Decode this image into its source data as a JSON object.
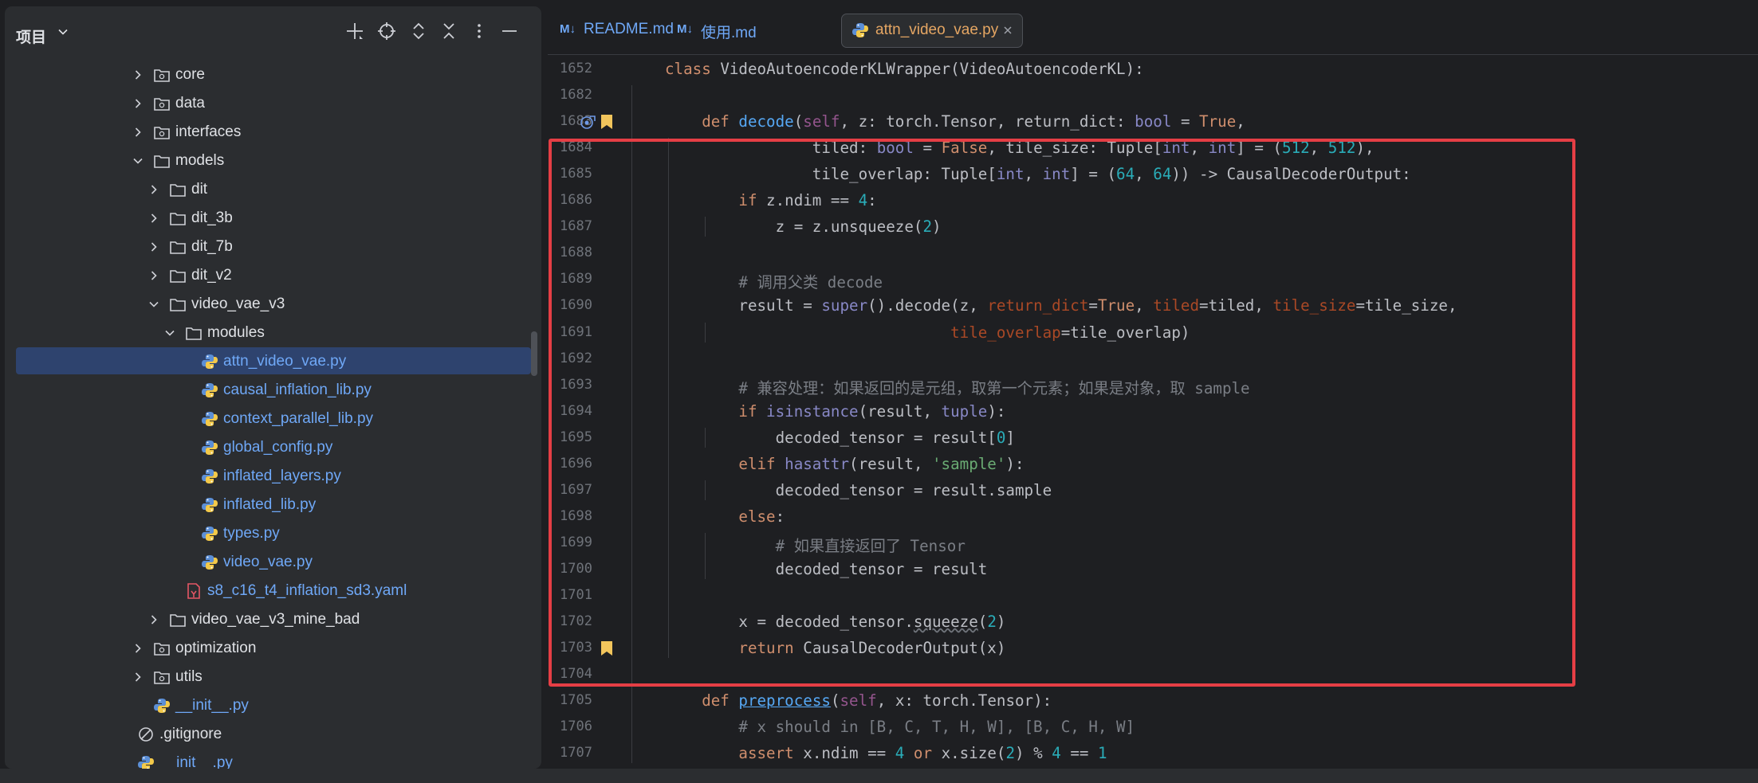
{
  "project_panel": {
    "title": "项目",
    "toolbar_icons": [
      "add-icon",
      "locate-icon",
      "expand-all-icon",
      "collapse-all-icon",
      "more-options-icon",
      "hide-icon"
    ],
    "tree": [
      {
        "label": "core",
        "kind": "package",
        "depth": 2,
        "expanded": false
      },
      {
        "label": "data",
        "kind": "package",
        "depth": 2,
        "expanded": false
      },
      {
        "label": "interfaces",
        "kind": "package",
        "depth": 2,
        "expanded": false
      },
      {
        "label": "models",
        "kind": "folder",
        "depth": 2,
        "expanded": true
      },
      {
        "label": "dit",
        "kind": "folder",
        "depth": 3,
        "expanded": false
      },
      {
        "label": "dit_3b",
        "kind": "folder",
        "depth": 3,
        "expanded": false
      },
      {
        "label": "dit_7b",
        "kind": "folder",
        "depth": 3,
        "expanded": false
      },
      {
        "label": "dit_v2",
        "kind": "folder",
        "depth": 3,
        "expanded": false
      },
      {
        "label": "video_vae_v3",
        "kind": "folder",
        "depth": 3,
        "expanded": true
      },
      {
        "label": "modules",
        "kind": "folder",
        "depth": 4,
        "expanded": true
      },
      {
        "label": "attn_video_vae.py",
        "kind": "python",
        "depth": 5,
        "selected": true
      },
      {
        "label": "causal_inflation_lib.py",
        "kind": "python",
        "depth": 5
      },
      {
        "label": "context_parallel_lib.py",
        "kind": "python",
        "depth": 5
      },
      {
        "label": "global_config.py",
        "kind": "python",
        "depth": 5
      },
      {
        "label": "inflated_layers.py",
        "kind": "python",
        "depth": 5
      },
      {
        "label": "inflated_lib.py",
        "kind": "python",
        "depth": 5
      },
      {
        "label": "types.py",
        "kind": "python",
        "depth": 5
      },
      {
        "label": "video_vae.py",
        "kind": "python",
        "depth": 5
      },
      {
        "label": "s8_c16_t4_inflation_sd3.yaml",
        "kind": "yaml",
        "depth": 4
      },
      {
        "label": "video_vae_v3_mine_bad",
        "kind": "folder",
        "depth": 3,
        "expanded": false
      },
      {
        "label": "optimization",
        "kind": "package",
        "depth": 2,
        "expanded": false
      },
      {
        "label": "utils",
        "kind": "package",
        "depth": 2,
        "expanded": false
      },
      {
        "label": "__init__.py",
        "kind": "python",
        "depth": 2
      },
      {
        "label": ".gitignore",
        "kind": "ignore",
        "depth": 1
      },
      {
        "label": "__init__.py",
        "kind": "python",
        "depth": 1
      }
    ]
  },
  "editor": {
    "tabs": [
      {
        "label": "README.md",
        "icon": "markdown-icon",
        "active": false,
        "modified": false
      },
      {
        "label": "使用.md",
        "icon": "markdown-icon",
        "active": false,
        "modified": false
      },
      {
        "label": "attn_video_vae.py",
        "icon": "python-icon",
        "active": true,
        "modified": true
      }
    ],
    "markdown_badge": "M↓",
    "lines": [
      {
        "n": "1652",
        "tokens": [
          [
            "kw",
            "class "
          ],
          [
            "",
            "VideoAutoencoderKLWrapper(VideoAutoencoderKL):"
          ]
        ]
      },
      {
        "n": "1682",
        "tokens": []
      },
      {
        "n": "1683",
        "markers": [
          "recursion",
          "bookmark"
        ],
        "indent": 1,
        "tokens": [
          [
            "kw",
            "def "
          ],
          [
            "fn",
            "decode"
          ],
          [
            "",
            "("
          ],
          [
            "self",
            "self"
          ],
          [
            "",
            ", z: torch.Tensor, return_dict: "
          ],
          [
            "bi",
            "bool"
          ],
          [
            "",
            " = "
          ],
          [
            "kw",
            "True"
          ],
          [
            "",
            ","
          ]
        ]
      },
      {
        "n": "1684",
        "indent": 1,
        "tokens": [
          [
            "",
            "            tiled: "
          ],
          [
            "bi",
            "bool"
          ],
          [
            "",
            " = "
          ],
          [
            "kw",
            "False"
          ],
          [
            "",
            ", tile_size: Tuple["
          ],
          [
            "bi",
            "int"
          ],
          [
            "",
            ", "
          ],
          [
            "bi",
            "int"
          ],
          [
            "",
            "] = ("
          ],
          [
            "num",
            "512"
          ],
          [
            "",
            ", "
          ],
          [
            "num",
            "512"
          ],
          [
            "",
            "),"
          ]
        ]
      },
      {
        "n": "1685",
        "indent": 1,
        "tokens": [
          [
            "",
            "            tile_overlap: Tuple["
          ],
          [
            "bi",
            "int"
          ],
          [
            "",
            ", "
          ],
          [
            "bi",
            "int"
          ],
          [
            "",
            "] = ("
          ],
          [
            "num",
            "64"
          ],
          [
            "",
            ", "
          ],
          [
            "num",
            "64"
          ],
          [
            "",
            ")) -> CausalDecoderOutput:"
          ]
        ]
      },
      {
        "n": "1686",
        "indent": 2,
        "tokens": [
          [
            "kw",
            "if "
          ],
          [
            "",
            "z.ndim == "
          ],
          [
            "num",
            "4"
          ],
          [
            "",
            ":"
          ]
        ]
      },
      {
        "n": "1687",
        "indent": 3,
        "tokens": [
          [
            "",
            "z = z.unsqueeze("
          ],
          [
            "num",
            "2"
          ],
          [
            "",
            ")"
          ]
        ]
      },
      {
        "n": "1688",
        "tokens": []
      },
      {
        "n": "1689",
        "indent": 2,
        "tokens": [
          [
            "cmt",
            "# 调用父类 decode"
          ]
        ]
      },
      {
        "n": "1690",
        "indent": 2,
        "tokens": [
          [
            "",
            "result = "
          ],
          [
            "bi",
            "super"
          ],
          [
            "",
            "().decode(z, "
          ],
          [
            "param",
            "return_dict"
          ],
          [
            "",
            "="
          ],
          [
            "kw",
            "True"
          ],
          [
            "",
            ", "
          ],
          [
            "param",
            "tiled"
          ],
          [
            "",
            "=tiled, "
          ],
          [
            "param",
            "tile_size"
          ],
          [
            "",
            "=tile_size,"
          ]
        ]
      },
      {
        "n": "1691",
        "indent": 2,
        "tokens": [
          [
            "",
            "                       "
          ],
          [
            "param",
            "tile_overlap"
          ],
          [
            "",
            "=tile_overlap)"
          ]
        ]
      },
      {
        "n": "1692",
        "tokens": []
      },
      {
        "n": "1693",
        "indent": 2,
        "tokens": [
          [
            "cmt",
            "# 兼容处理：如果返回的是元组，取第一个元素；如果是对象，取 sample"
          ]
        ]
      },
      {
        "n": "1694",
        "indent": 2,
        "tokens": [
          [
            "kw",
            "if "
          ],
          [
            "bi",
            "isinstance"
          ],
          [
            "",
            "(result, "
          ],
          [
            "bi",
            "tuple"
          ],
          [
            "",
            "):"
          ]
        ]
      },
      {
        "n": "1695",
        "indent": 3,
        "tokens": [
          [
            "",
            "decoded_tensor = result["
          ],
          [
            "num",
            "0"
          ],
          [
            "",
            "]"
          ]
        ]
      },
      {
        "n": "1696",
        "indent": 2,
        "tokens": [
          [
            "kw",
            "elif "
          ],
          [
            "bi",
            "hasattr"
          ],
          [
            "",
            "(result, "
          ],
          [
            "str",
            "'sample'"
          ],
          [
            "",
            "):"
          ]
        ]
      },
      {
        "n": "1697",
        "indent": 3,
        "tokens": [
          [
            "",
            "decoded_tensor = result.sample"
          ]
        ]
      },
      {
        "n": "1698",
        "indent": 2,
        "tokens": [
          [
            "kw",
            "else"
          ],
          [
            "",
            ":"
          ]
        ]
      },
      {
        "n": "1699",
        "indent": 3,
        "tokens": [
          [
            "cmt",
            "# 如果直接返回了 Tensor"
          ]
        ]
      },
      {
        "n": "1700",
        "indent": 3,
        "tokens": [
          [
            "",
            "decoded_tensor = result"
          ]
        ]
      },
      {
        "n": "1701",
        "tokens": []
      },
      {
        "n": "1702",
        "indent": 2,
        "tokens": [
          [
            "",
            "x = decoded_tensor."
          ],
          [
            "wav",
            "squeeze"
          ],
          [
            "",
            "("
          ],
          [
            "num",
            "2"
          ],
          [
            "",
            ")"
          ]
        ]
      },
      {
        "n": "1703",
        "markers": [
          "bookmark"
        ],
        "indent": 2,
        "tokens": [
          [
            "kw",
            "return "
          ],
          [
            "",
            "CausalDecoderOutput(x)"
          ]
        ]
      },
      {
        "n": "1704",
        "tokens": []
      },
      {
        "n": "1705",
        "indent": 1,
        "tokens": [
          [
            "kw",
            "def "
          ],
          [
            "dfn",
            "preprocess"
          ],
          [
            "",
            "("
          ],
          [
            "self",
            "self"
          ],
          [
            "",
            ", x: torch.Tensor):"
          ]
        ]
      },
      {
        "n": "1706",
        "indent": 2,
        "tokens": [
          [
            "cmt",
            "# x should in [B, C, T, H, W], [B, C, H, W]"
          ]
        ]
      },
      {
        "n": "1707",
        "indent": 2,
        "tokens": [
          [
            "kw",
            "assert "
          ],
          [
            "",
            "x.ndim == "
          ],
          [
            "num",
            "4"
          ],
          [
            "kw",
            " or "
          ],
          [
            "",
            "x.size("
          ],
          [
            "num",
            "2"
          ],
          [
            "",
            ") % "
          ],
          [
            "num",
            "4"
          ],
          [
            "",
            " == "
          ],
          [
            "num",
            "1"
          ]
        ]
      }
    ]
  },
  "colors": {
    "accent": "#2e436e",
    "keyword": "#cf8e6d",
    "function": "#56a8f5",
    "number": "#2aacb8",
    "string": "#6aab73",
    "comment": "#7a7e85",
    "highlight_border": "#e53e45"
  }
}
